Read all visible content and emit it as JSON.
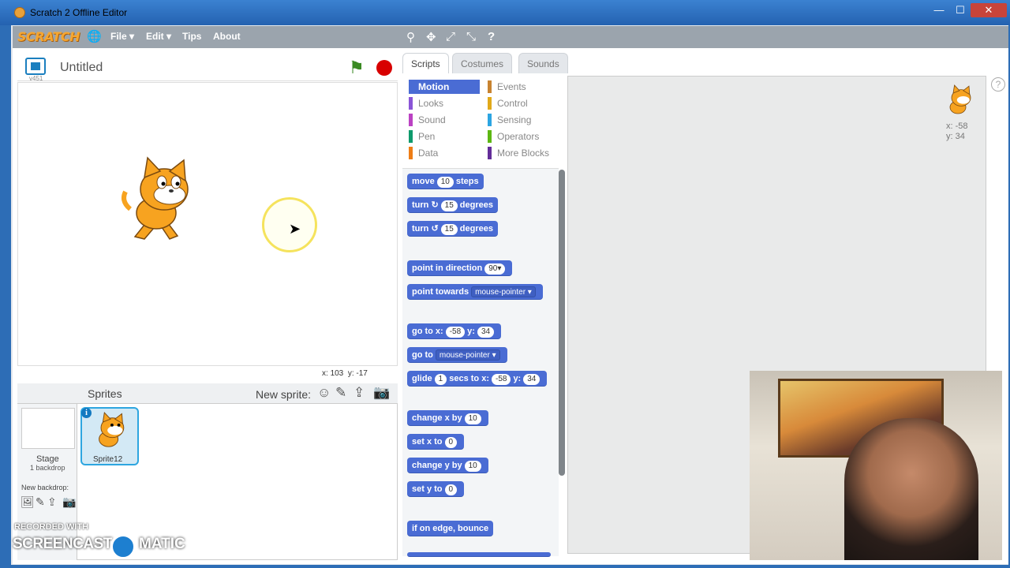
{
  "window": {
    "title": "Scratch 2 Offline Editor",
    "min": "—",
    "max": "☐",
    "close": "✕"
  },
  "menubar": {
    "logo": "SCRATCH",
    "globe": "🌐",
    "items": [
      "File ▾",
      "Edit ▾",
      "Tips",
      "About"
    ],
    "tools": [
      "⚲",
      "✥",
      "⤢",
      "⤡",
      "?"
    ]
  },
  "stage": {
    "version": "v451",
    "project_title": "Untitled",
    "flag": "⚑",
    "mouse_x_label": "x:",
    "mouse_x": "103",
    "mouse_y_label": "y:",
    "mouse_y": "-17"
  },
  "sprites": {
    "header": "Sprites",
    "new_sprite": "New sprite:",
    "new_sprite_icons": [
      "☺",
      "✎",
      "⇪",
      "📷"
    ],
    "stage_label": "Stage",
    "backdrop_count": "1 backdrop",
    "new_backdrop": "New backdrop:",
    "new_backdrop_icons": [
      "🖼",
      "✎",
      "⇪",
      "📷"
    ],
    "sprite_name": "Sprite12",
    "info": "i"
  },
  "tabs": [
    "Scripts",
    "Costumes",
    "Sounds"
  ],
  "categories": [
    {
      "label": "Motion",
      "color": "#4a6cd4"
    },
    {
      "label": "Looks",
      "color": "#8a55d7"
    },
    {
      "label": "Sound",
      "color": "#bb42c3"
    },
    {
      "label": "Pen",
      "color": "#0e9a6c"
    },
    {
      "label": "Data",
      "color": "#ee7d16"
    },
    {
      "label": "Events",
      "color": "#c88330"
    },
    {
      "label": "Control",
      "color": "#e1a91a"
    },
    {
      "label": "Sensing",
      "color": "#2ca5e2"
    },
    {
      "label": "Operators",
      "color": "#5cb712"
    },
    {
      "label": "More Blocks",
      "color": "#632d99"
    }
  ],
  "blocks": {
    "move": {
      "a": "move",
      "v": "10",
      "b": "steps"
    },
    "turn_cw": {
      "a": "turn",
      "icon": "↻",
      "v": "15",
      "b": "degrees"
    },
    "turn_ccw": {
      "a": "turn",
      "icon": "↺",
      "v": "15",
      "b": "degrees"
    },
    "point_dir": {
      "a": "point in direction",
      "v": "90▾"
    },
    "point_towards": {
      "a": "point towards",
      "v": "mouse-pointer ▾"
    },
    "goto_xy": {
      "a": "go to x:",
      "x": "-58",
      "b": "y:",
      "y": "34"
    },
    "goto": {
      "a": "go to",
      "v": "mouse-pointer ▾"
    },
    "glide": {
      "a": "glide",
      "s": "1",
      "b": "secs to x:",
      "x": "-58",
      "c": "y:",
      "y": "34"
    },
    "change_x": {
      "a": "change x by",
      "v": "10"
    },
    "set_x": {
      "a": "set x to",
      "v": "0"
    },
    "change_y": {
      "a": "change y by",
      "v": "10"
    },
    "set_y": {
      "a": "set y to",
      "v": "0"
    },
    "bounce": {
      "a": "if on edge, bounce"
    }
  },
  "script_area": {
    "x_label": "x: -58",
    "y_label": "y: 34",
    "help": "?"
  },
  "watermark": {
    "recorded": "RECORDED WITH",
    "brand": "SCREENCAST",
    "brand2": "MATIC"
  },
  "colors": {
    "motion": "#4a6cd4",
    "stage_border": "#2ea6e0",
    "flag": "#3a8a23",
    "stop": "#d80000"
  }
}
